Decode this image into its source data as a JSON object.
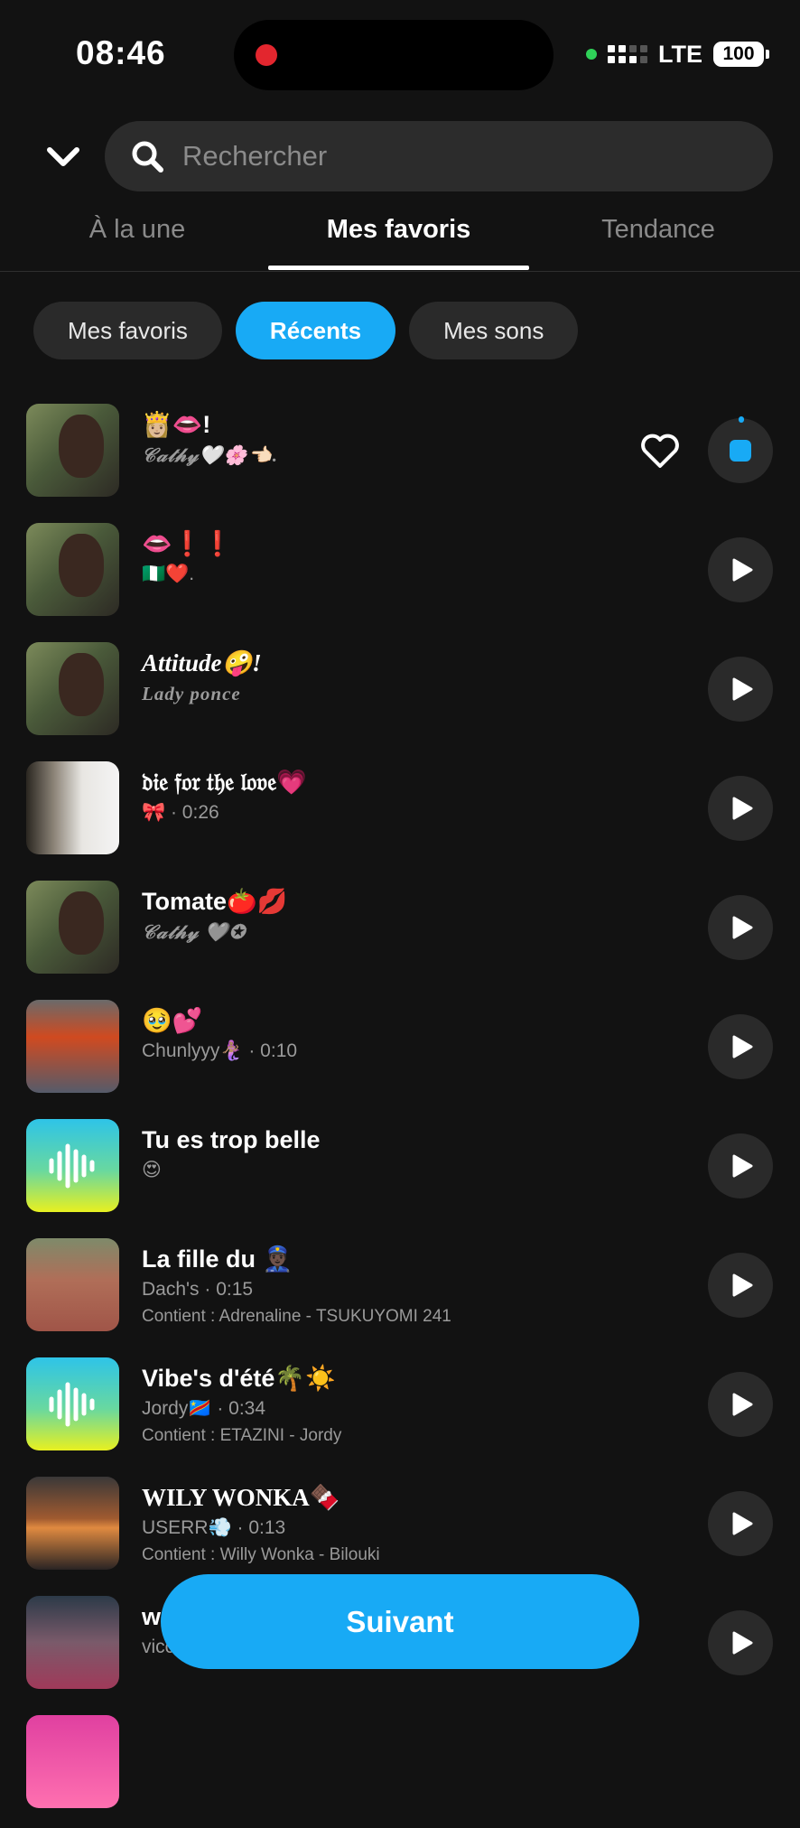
{
  "status_bar": {
    "time": "08:46",
    "network": "LTE",
    "battery": "100"
  },
  "search": {
    "placeholder": "Rechercher"
  },
  "tabs": [
    {
      "label": "À la une"
    },
    {
      "label": "Mes favoris",
      "active": true
    },
    {
      "label": "Tendance"
    }
  ],
  "filters": [
    {
      "label": "Mes favoris"
    },
    {
      "label": "Récents",
      "active": true
    },
    {
      "label": "Mes sons"
    }
  ],
  "sounds": [
    {
      "title": "👸🏼👄!",
      "subtitle": "𝒞𝒶𝓉𝒽𝓎🤍🌸👈🏻.",
      "thumb": "photo",
      "state": "playing",
      "favorite_icon": "heart-outline-icon"
    },
    {
      "title": "👄❗❗",
      "subtitle": "🇳🇬❤️.",
      "thumb": "photo",
      "state": "idle"
    },
    {
      "title": "Attitude🤪!",
      "subtitle": "Lady ponce",
      "thumb": "photo",
      "state": "idle"
    },
    {
      "title": "𝔡𝔦𝔢 𝔣𝔬𝔯 𝔱𝔥𝔢 𝔩𝔬𝔳𝔢💗",
      "subtitle": "🎀 · 0:26",
      "thumb": "gallery",
      "state": "idle"
    },
    {
      "title": "Tomate🍅💋",
      "subtitle": "𝒞𝒶𝓉𝒽𝓎 🩶✪",
      "thumb": "photo",
      "state": "idle"
    },
    {
      "title": "🥹💕",
      "subtitle": "Chunlyyy🧜🏽‍♀️ · 0:10",
      "thumb": "redhair",
      "state": "idle"
    },
    {
      "title": "Tu es trop belle",
      "subtitle": "😍",
      "thumb": "wave",
      "state": "idle"
    },
    {
      "title": "La fille du 👮🏿‍♂️",
      "subtitle": "Dach's · 0:15",
      "contains": "Contient : Adrenaline - TSUKUYOMI 241",
      "thumb": "headwrap",
      "state": "idle"
    },
    {
      "title": "Vibe's d'été🌴☀️",
      "subtitle": "Jordy🇨🇩 · 0:34",
      "contains": "Contient : ETAZINI - Jordy",
      "thumb": "wave",
      "state": "idle"
    },
    {
      "title": "WILY WONKA🍫",
      "subtitle": "USERR💨 · 0:13",
      "contains": "Contient : Willy Wonka - Bilouki",
      "thumb": "sunset",
      "state": "idle"
    },
    {
      "title": "w",
      "subtitle": "vicc",
      "thumb": "doll",
      "state": "idle"
    }
  ],
  "next_button": {
    "label": "Suivant"
  },
  "colors": {
    "accent": "#18aaf5",
    "background": "#121212",
    "surface": "#2a2a2a"
  }
}
